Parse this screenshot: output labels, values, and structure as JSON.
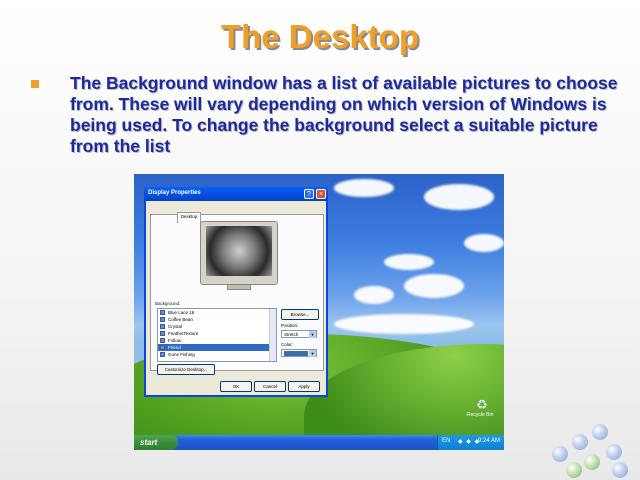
{
  "slide": {
    "title": "The Desktop",
    "bullet": "The Background window has a list of available pictures to choose from. These will vary depending on which version of Windows is being used. To change the background select a suitable picture from the list"
  },
  "dialog": {
    "title": "Display Properties",
    "help_glyph": "?",
    "close_glyph": "×",
    "tabs": [
      "Themes",
      "Desktop",
      "Screen Saver",
      "Appearance",
      "Settings"
    ],
    "active_tab": "Desktop",
    "background_label": "Background:",
    "backgrounds": [
      "Blue Lace 16",
      "Coffee Bean",
      "Crystal",
      "FeatherTexture",
      "Follow",
      "Friend",
      "Gone Fishing"
    ],
    "selected_background": "Friend",
    "browse_label": "Browse...",
    "position_label": "Position:",
    "position_value": "Stretch",
    "color_label": "Color:",
    "color_value": "#3a6ea5",
    "customize_label": "Customize Desktop...",
    "ok_label": "OK",
    "cancel_label": "Cancel",
    "apply_label": "Apply"
  },
  "taskbar": {
    "start_label": "start",
    "tray_lang": "EN",
    "tray_icons": "◆ ◆ ◆",
    "clock": "9:24 AM"
  },
  "desktop": {
    "recycle_label": "Recycle Bin"
  },
  "colors": {
    "title": "#f0a028",
    "bullet_text": "#1c2a9c",
    "xp_blue": "#0453e6"
  }
}
